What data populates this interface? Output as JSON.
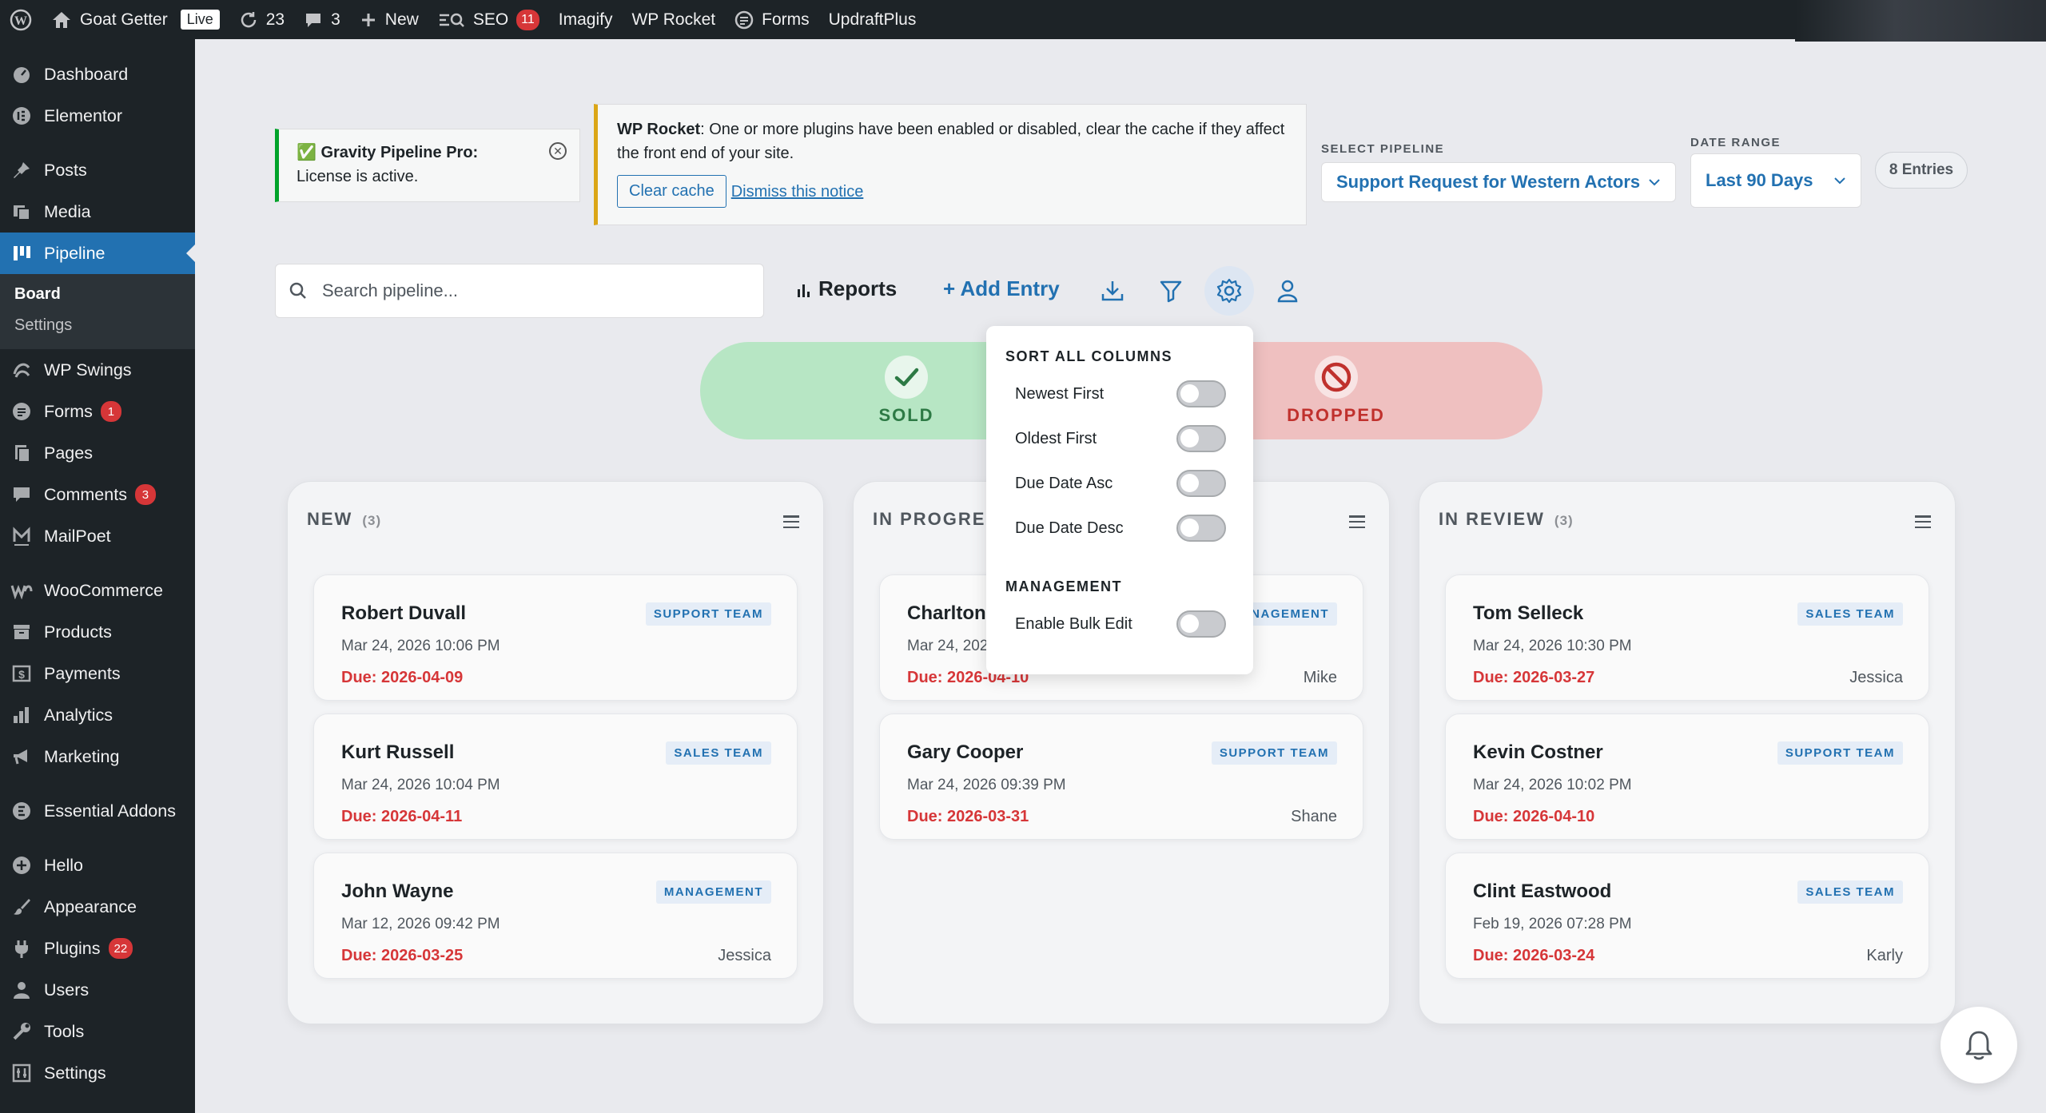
{
  "adminbar": {
    "site_name": "Goat Getter",
    "live_label": "Live",
    "updates_count": "23",
    "comments_count": "3",
    "new_label": "New",
    "seo_label": "SEO",
    "seo_count": "11",
    "imagify_label": "Imagify",
    "wprocket_label": "WP Rocket",
    "forms_label": "Forms",
    "updraft_label": "UpdraftPlus"
  },
  "sidebar": {
    "dashboard": "Dashboard",
    "elementor": "Elementor",
    "posts": "Posts",
    "media": "Media",
    "pipeline": "Pipeline",
    "board": "Board",
    "settings_sub": "Settings",
    "wp_swings": "WP Swings",
    "forms": "Forms",
    "forms_count": "1",
    "pages": "Pages",
    "comments": "Comments",
    "comments_count": "3",
    "mailpoet": "MailPoet",
    "woocommerce": "WooCommerce",
    "products": "Products",
    "payments": "Payments",
    "analytics": "Analytics",
    "marketing": "Marketing",
    "essential_addons": "Essential Addons",
    "hello": "Hello",
    "appearance": "Appearance",
    "plugins": "Plugins",
    "plugins_count": "22",
    "users": "Users",
    "tools": "Tools",
    "settings": "Settings"
  },
  "notices": {
    "gpp_check": "✅",
    "gpp_title": "Gravity Pipeline Pro:",
    "gpp_text": "License is active.",
    "rocket_title": "WP Rocket",
    "rocket_text": ": One or more plugins have been enabled or disabled, clear the cache if they affect the front end of your site.",
    "clear_cache": "Clear cache",
    "dismiss": "Dismiss this notice"
  },
  "filters": {
    "pipeline_label": "SELECT PIPELINE",
    "pipeline_value": "Support Request for Western Actors",
    "date_label": "DATE RANGE",
    "date_value": "Last 90 Days",
    "entries": "8 Entries"
  },
  "toolbar": {
    "search_placeholder": "Search pipeline...",
    "reports": "Reports",
    "add_entry": "+ Add Entry"
  },
  "zones": {
    "sold": "SOLD",
    "dropped": "DROPPED"
  },
  "sort_menu": {
    "sort_heading": "SORT ALL COLUMNS",
    "newest": "Newest First",
    "oldest": "Oldest First",
    "due_asc": "Due Date Asc",
    "due_desc": "Due Date Desc",
    "mgmt_heading": "MANAGEMENT",
    "bulk_edit": "Enable Bulk Edit"
  },
  "columns": [
    {
      "title": "NEW",
      "count": "(3)",
      "cards": [
        {
          "name": "Robert Duvall",
          "date": "Mar 24, 2026 10:06 PM",
          "due": "Due: 2026-04-09",
          "team": "SUPPORT TEAM",
          "owner": ""
        },
        {
          "name": "Kurt Russell",
          "date": "Mar 24, 2026 10:04 PM",
          "due": "Due: 2026-04-11",
          "team": "SALES TEAM",
          "owner": ""
        },
        {
          "name": "John Wayne",
          "date": "Mar 12, 2026 09:42 PM",
          "due": "Due: 2026-03-25",
          "team": "MANAGEMENT",
          "owner": "Jessica"
        }
      ]
    },
    {
      "title": "IN PROGRES",
      "count": "",
      "cards": [
        {
          "name": "Charlton",
          "date": "Mar 24, 202",
          "due": "Due: 2026-04-10",
          "team": "NAGEMENT",
          "owner": "Mike"
        },
        {
          "name": "Gary Cooper",
          "date": "Mar 24, 2026 09:39 PM",
          "due": "Due: 2026-03-31",
          "team": "SUPPORT TEAM",
          "owner": "Shane"
        }
      ]
    },
    {
      "title": "IN REVIEW",
      "count": "(3)",
      "cards": [
        {
          "name": "Tom Selleck",
          "date": "Mar 24, 2026 10:30 PM",
          "due": "Due: 2026-03-27",
          "team": "SALES TEAM",
          "owner": "Jessica"
        },
        {
          "name": "Kevin Costner",
          "date": "Mar 24, 2026 10:02 PM",
          "due": "Due: 2026-04-10",
          "team": "SUPPORT TEAM",
          "owner": ""
        },
        {
          "name": "Clint Eastwood",
          "date": "Feb 19, 2026 07:28 PM",
          "due": "Due: 2026-03-24",
          "team": "SALES TEAM",
          "owner": "Karly"
        }
      ]
    }
  ],
  "colors": {
    "accent": "#2271b1",
    "danger": "#d63638",
    "sold_bg": "#b7e6c4",
    "dropped_bg": "#efc0c0"
  }
}
